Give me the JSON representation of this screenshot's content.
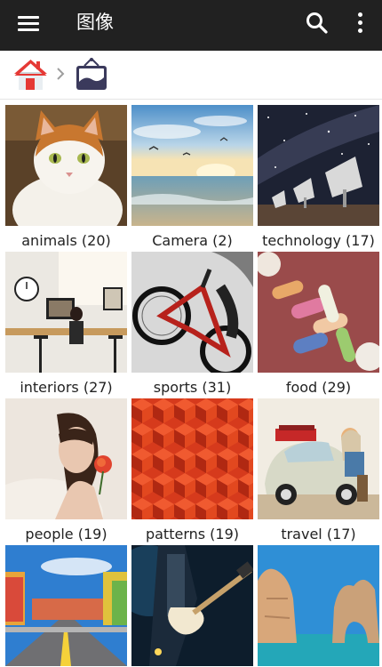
{
  "app_bar": {
    "title": "图像",
    "menu_icon": "hamburger-menu-icon",
    "search_icon": "search-icon",
    "more_icon": "more-vert-icon"
  },
  "breadcrumb": {
    "home_icon": "home-icon",
    "separator_icon": "chevron-right-icon",
    "current_icon": "picture-album-icon"
  },
  "albums": [
    {
      "label": "animals (20)",
      "thumbnail": "cat"
    },
    {
      "label": "Camera (2)",
      "thumbnail": "seascape"
    },
    {
      "label": "technology (17)",
      "thumbnail": "radio-telescopes"
    },
    {
      "label": "interiors (27)",
      "thumbnail": "cafe-interior"
    },
    {
      "label": "sports (31)",
      "thumbnail": "bmx-rider"
    },
    {
      "label": "food (29)",
      "thumbnail": "macarons"
    },
    {
      "label": "people (19)",
      "thumbnail": "woman-with-flower"
    },
    {
      "label": "patterns (19)",
      "thumbnail": "red-hexagon-pattern"
    },
    {
      "label": "travel (17)",
      "thumbnail": "vintage-car"
    },
    {
      "label": "",
      "thumbnail": "colorful-street"
    },
    {
      "label": "",
      "thumbnail": "guitar-player"
    },
    {
      "label": "",
      "thumbnail": "sea-arch"
    }
  ],
  "colors": {
    "app_bar": "#212121",
    "home_roof": "#e53935",
    "album_icon": "#3b3a5c"
  }
}
